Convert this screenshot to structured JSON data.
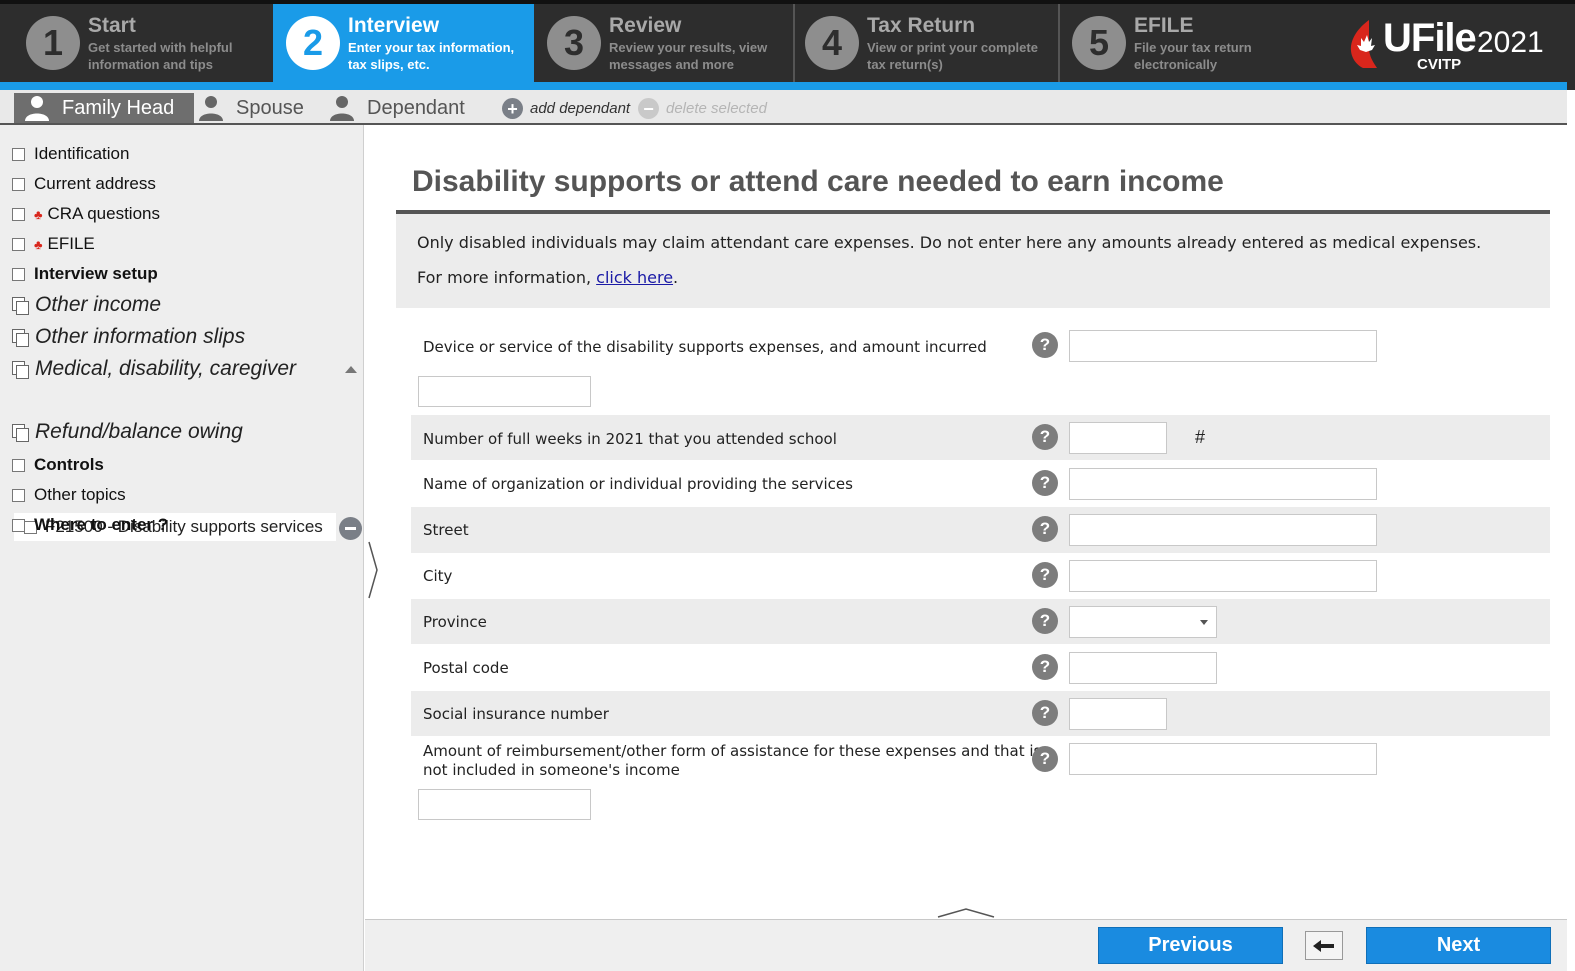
{
  "steps": [
    {
      "num": "1",
      "title": "Start",
      "desc1": "Get started with helpful",
      "desc2": "information and tips"
    },
    {
      "num": "2",
      "title": "Interview",
      "desc1": "Enter your tax information,",
      "desc2": "tax slips, etc."
    },
    {
      "num": "3",
      "title": "Review",
      "desc1": "Review your results, view",
      "desc2": "messages and more"
    },
    {
      "num": "4",
      "title": "Tax Return",
      "desc1": "View or print your complete",
      "desc2": "tax return(s)"
    },
    {
      "num": "5",
      "title": "EFILE",
      "desc1": "File your tax return",
      "desc2": "electronically"
    }
  ],
  "logo": {
    "brand": "UFile",
    "year": "2021",
    "sub": "CVITP"
  },
  "family": {
    "tabs": [
      "Family Head",
      "Spouse",
      "Dependant"
    ],
    "add_label": "add dependant",
    "delete_label": "delete selected"
  },
  "sidebar": {
    "items": [
      "Identification",
      "Current address",
      "CRA questions",
      "EFILE",
      "Interview setup",
      "Other income",
      "Other information slips",
      "Medical, disability, caregiver",
      "Refund/balance owing",
      "Controls",
      "Other topics",
      "Where to enter ?"
    ],
    "subitem": "F21500 - Disability supports services"
  },
  "main": {
    "title": "Disability supports or attend care needed to earn income",
    "info_line1": "Only disabled individuals may claim attendant care expenses. Do not enter here any amounts already entered as medical expenses.",
    "info_line2_prefix": "For more information, ",
    "info_link": "click here",
    "info_line2_suffix": ".",
    "help_glyph": "?",
    "fields": [
      {
        "label": "Device or service of the disability supports expenses, and amount incurred",
        "value": "",
        "amount": ""
      },
      {
        "label": "Number of full weeks in 2021 that you attended school",
        "value": "",
        "unit": "#"
      },
      {
        "label": "Name of organization or individual providing the services",
        "value": ""
      },
      {
        "label": "Street",
        "value": ""
      },
      {
        "label": "City",
        "value": ""
      },
      {
        "label": "Province",
        "value": ""
      },
      {
        "label": "Postal code",
        "value": ""
      },
      {
        "label": "Social insurance number",
        "value": ""
      },
      {
        "label_line1": "Amount of reimbursement/other form of assistance for these expenses and that is",
        "label_line2": "not included in someone's income",
        "value": "",
        "amount": ""
      }
    ]
  },
  "footer": {
    "previous": "Previous",
    "next": "Next"
  },
  "colors": {
    "accent": "#1a9be8",
    "button": "#1a8be0",
    "dark": "#2d2d2d",
    "leaf": "#d9261c"
  }
}
